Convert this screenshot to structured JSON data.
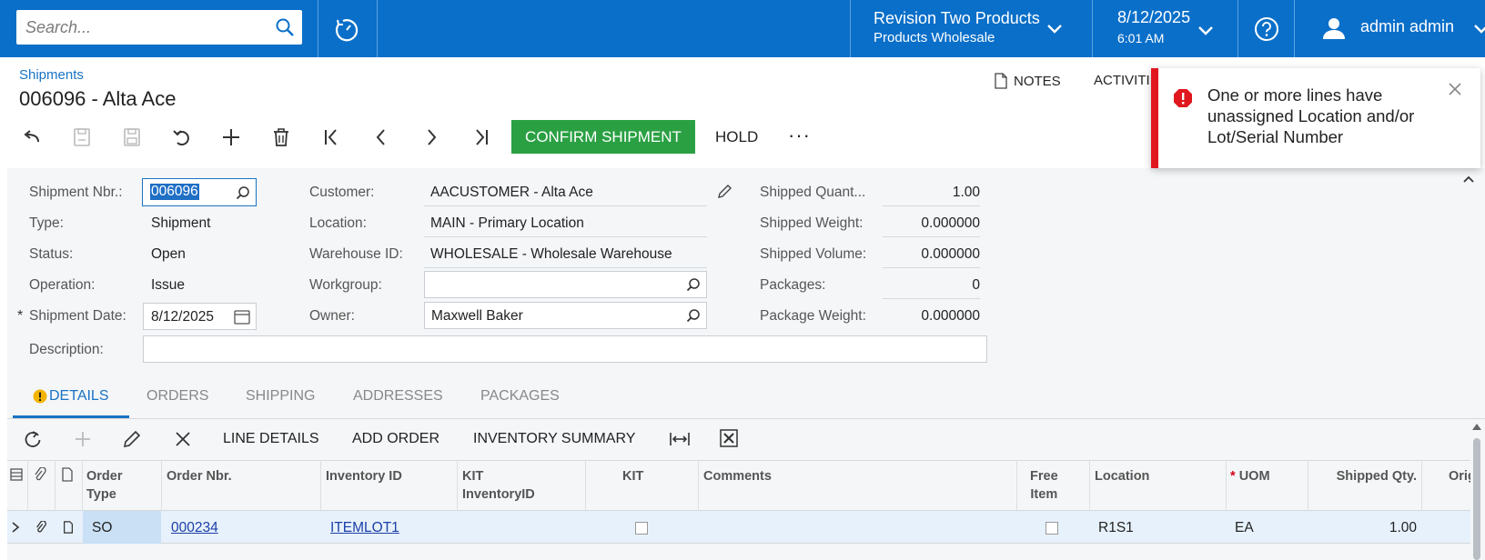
{
  "topbar": {
    "search_placeholder": "Search...",
    "tenant_name": "Revision Two Products",
    "tenant_branch": "Products Wholesale",
    "date": "8/12/2025",
    "time": "6:01 AM",
    "user": "admin admin"
  },
  "header": {
    "breadcrumb": "Shipments",
    "title": "006096 - Alta Ace",
    "notes": "NOTES",
    "activities": "ACTIVITI"
  },
  "toolbar": {
    "confirm": "CONFIRM SHIPMENT",
    "hold": "HOLD",
    "more": "···"
  },
  "form": {
    "shipment_nbr_label": "Shipment Nbr.:",
    "shipment_nbr": "006096",
    "type_label": "Type:",
    "type": "Shipment",
    "status_label": "Status:",
    "status": "Open",
    "operation_label": "Operation:",
    "operation": "Issue",
    "shipment_date_label": "Shipment Date:",
    "shipment_date": "8/12/2025",
    "description_label": "Description:",
    "customer_label": "Customer:",
    "customer": "AACUSTOMER - Alta Ace",
    "location_label": "Location:",
    "location": "MAIN - Primary Location",
    "warehouse_label": "Warehouse ID:",
    "warehouse": "WHOLESALE - Wholesale Warehouse",
    "workgroup_label": "Workgroup:",
    "owner_label": "Owner:",
    "owner": "Maxwell Baker",
    "shipped_qty_label": "Shipped Quant...",
    "shipped_qty": "1.00",
    "shipped_weight_label": "Shipped Weight:",
    "shipped_weight": "0.000000",
    "shipped_volume_label": "Shipped Volume:",
    "shipped_volume": "0.000000",
    "packages_label": "Packages:",
    "packages": "0",
    "package_weight_label": "Package Weight:",
    "package_weight": "0.000000"
  },
  "tabs": [
    "DETAILS",
    "ORDERS",
    "SHIPPING",
    "ADDRESSES",
    "PACKAGES"
  ],
  "grid_toolbar": {
    "line_details": "LINE DETAILS",
    "add_order": "ADD ORDER",
    "inventory_summary": "INVENTORY SUMMARY"
  },
  "grid": {
    "headers": {
      "order_type_1": "Order",
      "order_type_2": "Type",
      "order_nbr": "Order Nbr.",
      "inventory_id": "Inventory ID",
      "kit_inv_1": "KIT",
      "kit_inv_2": "InventoryID",
      "kit": "KIT",
      "comments": "Comments",
      "free_item_1": "Free",
      "free_item_2": "Item",
      "location": "Location",
      "uom_star": "*",
      "uom": "UOM",
      "shipped_qty": "Shipped Qty.",
      "orig": "Orig"
    },
    "rows": [
      {
        "order_type": "SO",
        "order_nbr": "000234",
        "inventory_id": "ITEMLOT1",
        "location": "R1S1",
        "uom": "EA",
        "shipped_qty": "1.00"
      }
    ]
  },
  "toast": {
    "message": "One or more lines have unassigned Location and/or Lot/Serial Number"
  },
  "colors": {
    "topbar": "#0a6fc9",
    "confirm": "#2aa043",
    "error": "#e0181e",
    "link": "#1a73c4"
  }
}
